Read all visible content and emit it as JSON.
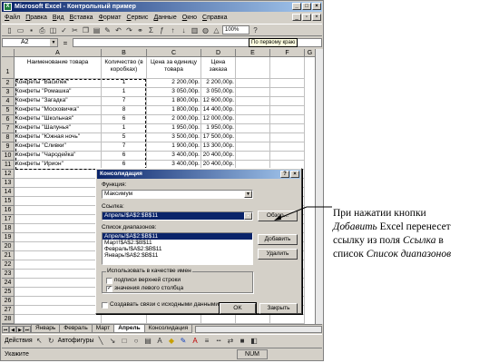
{
  "window": {
    "title": "Microsoft Excel - Контрольный пример",
    "app_icon": "excel-icon"
  },
  "menu": [
    "Файл",
    "Правка",
    "Вид",
    "Вставка",
    "Формат",
    "Сервис",
    "Данные",
    "Окно",
    "Справка"
  ],
  "toolbar": {
    "zoom": "100%",
    "tooltip": "По первому краю"
  },
  "formula_bar": {
    "name_box": "A2",
    "equals": "="
  },
  "columns": [
    "A",
    "B",
    "C",
    "D",
    "E",
    "F",
    "G"
  ],
  "rows": [
    "1",
    "2",
    "3",
    "4",
    "5",
    "6",
    "7",
    "8",
    "9",
    "10",
    "11",
    "12",
    "13",
    "14",
    "15",
    "16",
    "17",
    "18",
    "19",
    "20",
    "21",
    "22",
    "23",
    "24",
    "25",
    "26",
    "27",
    "28",
    "29"
  ],
  "table": {
    "headers": [
      "Наименование товара",
      "Количество (в коробках)",
      "Цена за единицу товара",
      "Цена заказа"
    ],
    "rows": [
      [
        "Конфеты \"Василек\"",
        "1",
        "2 200,00р.",
        "2 200,00р."
      ],
      [
        "Конфеты \"Ромашка\"",
        "1",
        "3 050,00р.",
        "3 050,00р."
      ],
      [
        "Конфеты \"Загадка\"",
        "7",
        "1 800,00р.",
        "12 600,00р."
      ],
      [
        "Конфеты \"Московичка\"",
        "8",
        "1 800,00р.",
        "14 400,00р."
      ],
      [
        "Конфеты \"Школьная\"",
        "6",
        "2 000,00р.",
        "12 000,00р."
      ],
      [
        "Конфеты \"Шалунья\"",
        "1",
        "1 950,00р.",
        "1 950,00р."
      ],
      [
        "Конфеты \"Южная ночь\"",
        "5",
        "3 500,00р.",
        "17 500,00р."
      ],
      [
        "Конфеты \"Сливки\"",
        "7",
        "1 900,00р.",
        "13 300,00р."
      ],
      [
        "Конфеты \"Чародейка\"",
        "6",
        "3 400,00р.",
        "20 400,00р."
      ],
      [
        "Конфеты \"Ирион\"",
        "6",
        "3 400,00р.",
        "20 400,00р."
      ]
    ]
  },
  "sheet_tabs": [
    "Январь",
    "Февраль",
    "Март",
    "Апрель",
    "Консолидация"
  ],
  "active_sheet": "Апрель",
  "draw_toolbar": {
    "actions": "Действия",
    "autoshapes": "Автофигуры"
  },
  "status": {
    "left": "Укажите",
    "num": "NUM"
  },
  "dialog": {
    "title": "Консолидация",
    "function_label": "Функция:",
    "function_value": "Максимум",
    "reference_label": "Ссылка:",
    "reference_value": "Апрель!$A$2:$B$11",
    "browse_button": "Обзор...",
    "ranges_label": "Список диапазонов:",
    "ranges": [
      "Апрель!$A$2:$B$11",
      "Март!$A$2:$B$11",
      "Февраль!$A$2:$B$11",
      "Январь!$A$2:$B$11"
    ],
    "add_button": "Добавить",
    "delete_button": "Удалить",
    "use_labels_legend": "Использовать в качестве имен",
    "top_row_label": "подписи верхней строки",
    "left_column_label": "значения левого столбца",
    "create_links_label": "Создавать связи с исходными данными",
    "ok_button": "OK",
    "close_button": "Закрыть"
  },
  "annotation": {
    "line1": "При нажатии кнопки",
    "line2_italic": "Добавить",
    "line2_rest": " Excel перенесет",
    "line3_start": "ссылку из поля ",
    "line3_italic": "Ссылка",
    "line3_end": " в",
    "line4_start": "список ",
    "line4_italic": "Список диапазонов"
  }
}
